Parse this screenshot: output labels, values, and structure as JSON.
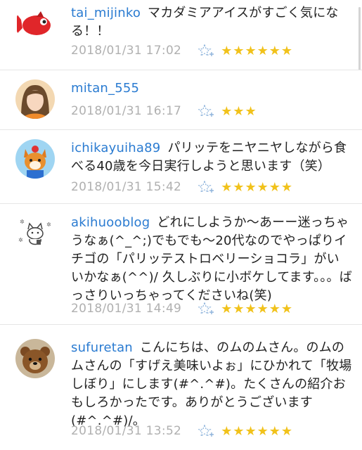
{
  "comments": [
    {
      "user": "tai_mijinko",
      "text": "マカダミアアイスがすごく気になる！！",
      "date": "2018/01/31 17:02",
      "stars": "★★★★★★",
      "avatar": "red-fish-avatar"
    },
    {
      "user": "mitan_555",
      "text": "",
      "date": "2018/01/31 16:17",
      "stars": "★★★",
      "avatar": "woman-avatar"
    },
    {
      "user": "ichikayuiha89",
      "text": "パリッテをニヤニヤしながら食べる40歳を今日実行しようと思います（笑）",
      "date": "2018/01/31 15:42",
      "stars": "★★★★★★",
      "avatar": "fox-avatar"
    },
    {
      "user": "akihuooblog",
      "text": "どれにしようか〜あーー迷っちゃうなぁ(^_^;)でもでも〜20代なのでやっぱりイチゴの「パリッテストロベリーショコラ」がいいかなぁ(^^)/ 久しぶりに小ボケしてます。。。ばっさりいっちゃってくださいね(笑)",
      "date": "2018/01/31 14:49",
      "stars": "★★★★★★",
      "avatar": "cat-sketch-avatar"
    },
    {
      "user": "sufuretan",
      "text": "こんにちは、のムのムさん。のムのムさんの「すげえ美味いよぉ」にひかれて「牧場しぼり」にします(#^.^#)。たくさんの紹介おもしろかったです。ありがとうございます(#^.^#)/。",
      "date": "2018/01/31 13:52",
      "stars": "★★★★★★",
      "avatar": "teddy-bear-avatar"
    }
  ],
  "colors": {
    "username": "#2a7bd1",
    "date": "#b0b0b0",
    "star": "#f1c21b",
    "fav_icon": "#8fb4dc"
  },
  "icons": {
    "favorite": "star-plus-icon"
  }
}
